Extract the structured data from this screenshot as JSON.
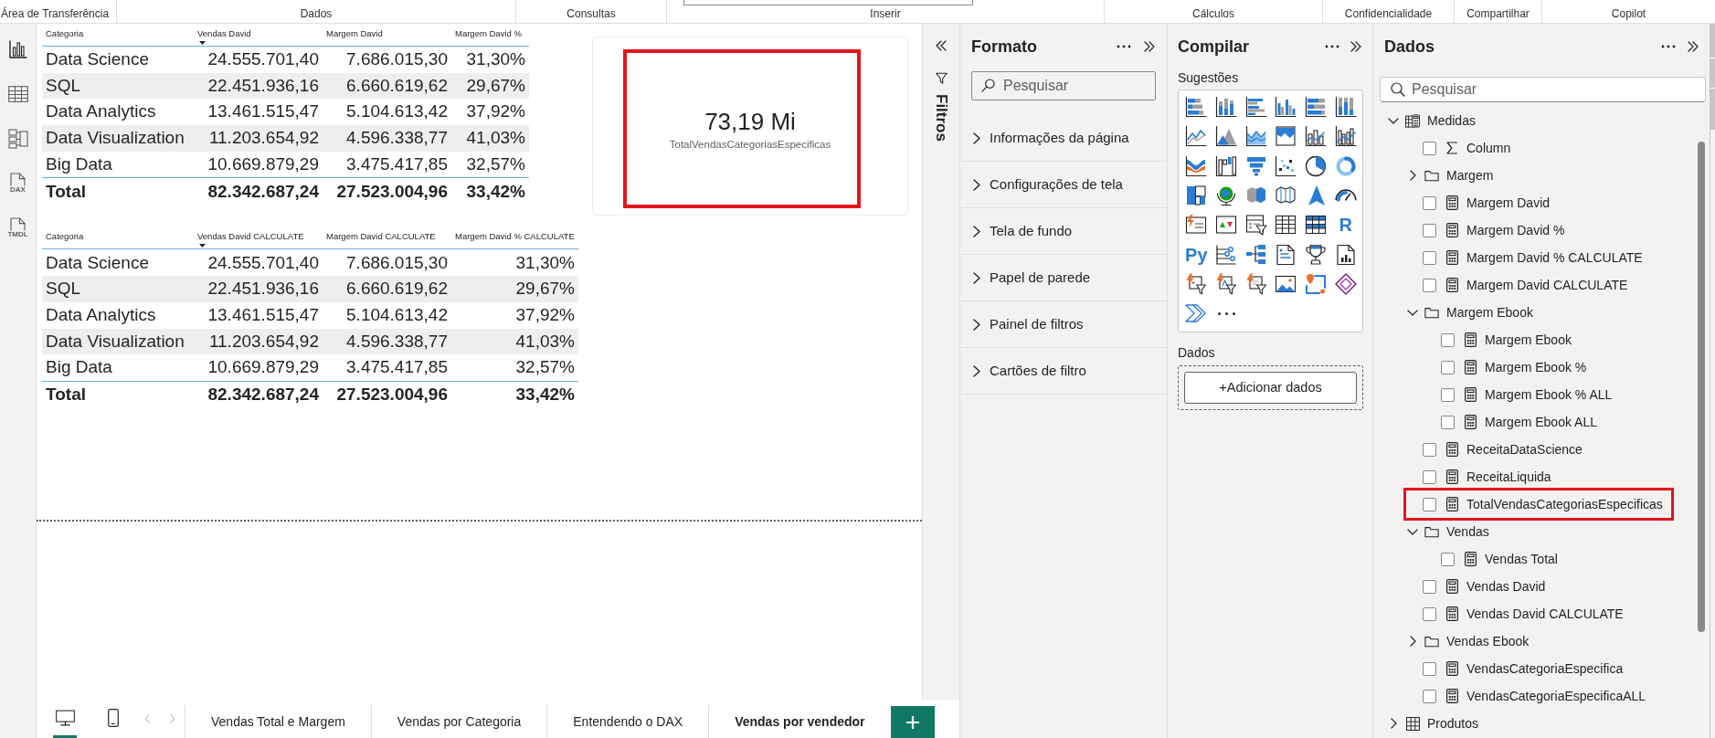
{
  "ribbon": {
    "groups": [
      "Área de Transferência",
      "Dados",
      "Consultas",
      "Inserir",
      "Cálculos",
      "Confidencialidade",
      "Compartilhar",
      "Copilot"
    ]
  },
  "nav": [
    {
      "kind": "report",
      "selected": true
    },
    {
      "kind": "table",
      "selected": false
    },
    {
      "kind": "model",
      "selected": false
    },
    {
      "kind": "dax",
      "label": "DAX",
      "selected": false
    },
    {
      "kind": "tmdl",
      "label": "TMDL",
      "selected": false
    }
  ],
  "canvas": {
    "tables": [
      {
        "columns": [
          {
            "label": "Categoria",
            "sorted": false
          },
          {
            "label": "Vendas David",
            "sorted": true
          },
          {
            "label": "Margem David",
            "sorted": false
          },
          {
            "label": "Margem David %",
            "sorted": false
          }
        ],
        "rows": [
          [
            "Data Science",
            "24.555.701,40",
            "7.686.015,30",
            "31,30%"
          ],
          [
            "SQL",
            "22.451.936,16",
            "6.660.619,62",
            "29,67%"
          ],
          [
            "Data Analytics",
            "13.461.515,47",
            "5.104.613,42",
            "37,92%"
          ],
          [
            "Data Visualization",
            "11.203.654,92",
            "4.596.338,77",
            "41,03%"
          ],
          [
            "Big Data",
            "10.669.879,29",
            "3.475.417,85",
            "32,57%"
          ]
        ],
        "total": [
          "Total",
          "82.342.687,24",
          "27.523.004,96",
          "33,42%"
        ]
      },
      {
        "columns": [
          {
            "label": "Categoria",
            "sorted": false
          },
          {
            "label": "Vendas David CALCULATE",
            "sorted": true
          },
          {
            "label": "Margem David CALCULATE",
            "sorted": false
          },
          {
            "label": "Margem David % CALCULATE",
            "sorted": false
          }
        ],
        "rows": [
          [
            "Data Science",
            "24.555.701,40",
            "7.686.015,30",
            "31,30%"
          ],
          [
            "SQL",
            "22.451.936,16",
            "6.660.619,62",
            "29,67%"
          ],
          [
            "Data Analytics",
            "13.461.515,47",
            "5.104.613,42",
            "37,92%"
          ],
          [
            "Data Visualization",
            "11.203.654,92",
            "4.596.338,77",
            "41,03%"
          ],
          [
            "Big Data",
            "10.669.879,29",
            "3.475.417,85",
            "32,57%"
          ]
        ],
        "total": [
          "Total",
          "82.342.687,24",
          "27.523.004,96",
          "33,42%"
        ]
      }
    ],
    "card": {
      "value": "73,19 Mi",
      "label": "TotalVendasCategoriasEspecificas",
      "highlighted": true
    }
  },
  "page_tabs": {
    "layouts": [
      {
        "kind": "desktop",
        "selected": true
      },
      {
        "kind": "mobile",
        "selected": false
      }
    ],
    "tabs": [
      {
        "label": "Vendas Total e Margem",
        "selected": false
      },
      {
        "label": "Vendas por Categoria",
        "selected": false
      },
      {
        "label": "Entendendo o DAX",
        "selected": false
      },
      {
        "label": "Vendas por vendedor",
        "selected": true
      }
    ]
  },
  "filters_pane": {
    "title": "Filtros"
  },
  "format_pane": {
    "title": "Formato",
    "search": {
      "placeholder": "Pesquisar"
    },
    "sections": [
      {
        "label": "Informações da página",
        "expanded": false
      },
      {
        "label": "Configurações de tela",
        "expanded": false
      },
      {
        "label": "Tela de fundo",
        "expanded": false
      },
      {
        "label": "Papel de parede",
        "expanded": false
      },
      {
        "label": "Painel de filtros",
        "expanded": false
      },
      {
        "label": "Cartões de filtro",
        "expanded": false
      }
    ]
  },
  "build_pane": {
    "title": "Compilar",
    "suggestions_label": "Sugestões",
    "text_visuals": [
      "R",
      "Py"
    ],
    "data_label": "Dados",
    "add_data_button": "+Adicionar dados"
  },
  "data_pane": {
    "title": "Dados",
    "search": {
      "placeholder": "Pesquisar"
    },
    "tree": [
      {
        "label": "Medidas",
        "kind": "measure_table",
        "expanded": true,
        "highlighted": false,
        "children": [
          {
            "label": "Column",
            "kind": "sum",
            "checked": false,
            "highlighted": false
          },
          {
            "label": "Margem",
            "kind": "folder",
            "expanded": false,
            "highlighted": false
          },
          {
            "label": "Margem David",
            "kind": "measure",
            "checked": false,
            "highlighted": false
          },
          {
            "label": "Margem David %",
            "kind": "measure",
            "checked": false,
            "highlighted": false
          },
          {
            "label": "Margem David % CALCULATE",
            "kind": "measure",
            "checked": false,
            "highlighted": false
          },
          {
            "label": "Margem David CALCULATE",
            "kind": "measure",
            "checked": false,
            "highlighted": false
          },
          {
            "label": "Margem Ebook",
            "kind": "folder",
            "expanded": true,
            "highlighted": false,
            "children": [
              {
                "label": "Margem Ebook",
                "kind": "measure",
                "checked": false,
                "highlighted": false
              },
              {
                "label": "Margem Ebook %",
                "kind": "measure",
                "checked": false,
                "highlighted": false
              },
              {
                "label": "Margem Ebook % ALL",
                "kind": "measure",
                "checked": false,
                "highlighted": false
              },
              {
                "label": "Margem Ebook ALL",
                "kind": "measure",
                "checked": false,
                "highlighted": false
              }
            ]
          },
          {
            "label": "ReceitaDataScience",
            "kind": "measure",
            "checked": false,
            "highlighted": false
          },
          {
            "label": "ReceitaLiquida",
            "kind": "measure",
            "checked": false,
            "highlighted": false
          },
          {
            "label": "TotalVendasCategoriasEspecificas",
            "kind": "measure",
            "checked": false,
            "highlighted": true
          },
          {
            "label": "Vendas",
            "kind": "folder",
            "expanded": true,
            "highlighted": false,
            "children": [
              {
                "label": "Vendas Total",
                "kind": "measure",
                "checked": false,
                "highlighted": false
              }
            ]
          },
          {
            "label": "Vendas David",
            "kind": "measure",
            "checked": false,
            "highlighted": false
          },
          {
            "label": "Vendas David CALCULATE",
            "kind": "measure",
            "checked": false,
            "highlighted": false
          },
          {
            "label": "Vendas Ebook",
            "kind": "folder",
            "expanded": false,
            "highlighted": false
          },
          {
            "label": "VendasCategoriaEspecifica",
            "kind": "measure",
            "checked": false,
            "highlighted": false
          },
          {
            "label": "VendasCategoriaEspecificaALL",
            "kind": "measure",
            "checked": false,
            "highlighted": false
          }
        ]
      },
      {
        "label": "Produtos",
        "kind": "table",
        "expanded": false,
        "highlighted": false
      }
    ]
  }
}
